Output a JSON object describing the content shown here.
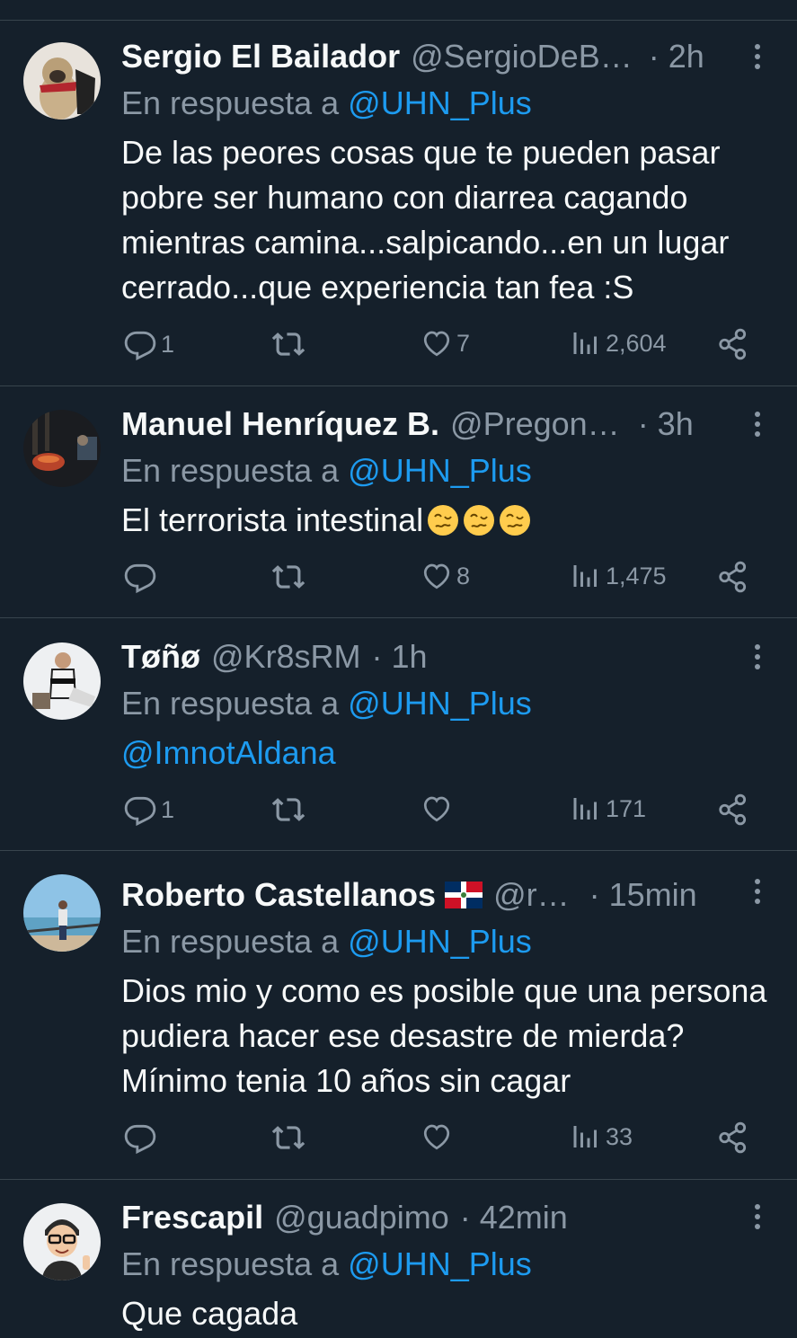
{
  "reply_prefix": "En respuesta a",
  "colors": {
    "background": "#15202b",
    "secondary_text": "#8b98a5",
    "accent": "#1d9bf0",
    "divider": "#38444d"
  },
  "tweets": [
    {
      "name": "Sergio El Bailador",
      "handle": "@SergioDeB…",
      "time": "· 2h",
      "reply_to": "@UHN_Plus",
      "text": "De las peores cosas que te pueden pasar pobre ser humano con diarrea cagando mientras camina...salpicando...en un lugar cerrado...que experiencia tan fea :S",
      "replies": "1",
      "retweets": "",
      "likes": "7",
      "views": "2,604"
    },
    {
      "name": "Manuel Henríquez B.",
      "handle": "@Pregon…",
      "time": "· 3h",
      "reply_to": "@UHN_Plus",
      "text": "El terrorista intestinal",
      "emoji": "woozy-face-emoji x3",
      "replies": "",
      "retweets": "",
      "likes": "8",
      "views": "1,475"
    },
    {
      "name": "Tøñø",
      "handle": "@Kr8sRM",
      "time": "· 1h",
      "reply_to": "@UHN_Plus",
      "text": "@ImnotAldana",
      "replies": "1",
      "retweets": "",
      "likes": "",
      "views": "171"
    },
    {
      "name": "Roberto Castellanos",
      "flag": "dominican-republic-flag-emoji",
      "handle": "@r…",
      "time": "· 15min",
      "reply_to": "@UHN_Plus",
      "text": "Dios mio y como es posible que una persona pudiera hacer ese desastre de mierda? Mínimo tenia 10 años sin cagar",
      "replies": "",
      "retweets": "",
      "likes": "",
      "views": "33"
    },
    {
      "name": "Frescapil",
      "handle": "@guadpimo",
      "time": "· 42min",
      "reply_to": "@UHN_Plus",
      "text": "Que cagada"
    }
  ]
}
